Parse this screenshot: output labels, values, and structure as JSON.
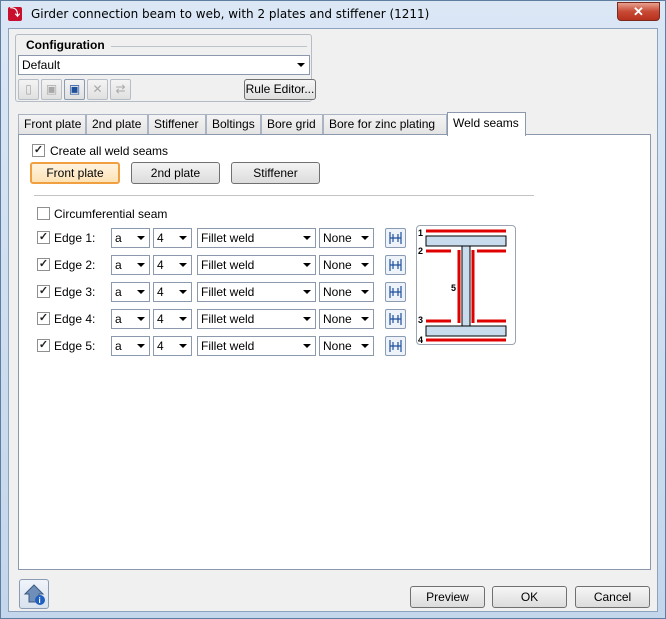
{
  "window": {
    "title": "Girder connection beam to web, with 2 plates and stiffener (1211)",
    "close_glyph": "✕"
  },
  "configuration": {
    "heading": "Configuration",
    "selected": "Default",
    "rule_editor_label": "Rule Editor..."
  },
  "tabs": [
    {
      "label": "Front plate"
    },
    {
      "label": "2nd plate"
    },
    {
      "label": "Stiffener"
    },
    {
      "label": "Boltings"
    },
    {
      "label": "Bore grid"
    },
    {
      "label": "Bore for zinc plating"
    },
    {
      "label": "Weld seams"
    }
  ],
  "weld": {
    "create_all_label": "Create all weld seams",
    "create_all_checked": true,
    "part_buttons": [
      "Front plate",
      "2nd plate",
      "Stiffener"
    ],
    "active_part": "Front plate",
    "circumferential_label": "Circumferential seam",
    "circumferential_checked": false,
    "edges": [
      {
        "label": "Edge 1:",
        "type": "a",
        "size": "4",
        "weld": "Fillet weld",
        "finish": "None",
        "checked": true
      },
      {
        "label": "Edge 2:",
        "type": "a",
        "size": "4",
        "weld": "Fillet weld",
        "finish": "None",
        "checked": true
      },
      {
        "label": "Edge 3:",
        "type": "a",
        "size": "4",
        "weld": "Fillet weld",
        "finish": "None",
        "checked": true
      },
      {
        "label": "Edge 4:",
        "type": "a",
        "size": "4",
        "weld": "Fillet weld",
        "finish": "None",
        "checked": true
      },
      {
        "label": "Edge 5:",
        "type": "a",
        "size": "4",
        "weld": "Fillet weld",
        "finish": "None",
        "checked": true
      }
    ],
    "diagram_labels": [
      "1",
      "2",
      "3",
      "4",
      "5"
    ],
    "weld_color": "#e00000",
    "plate_color": "#c8dcee"
  },
  "footer": {
    "preview_label": "Preview",
    "ok_label": "OK",
    "cancel_label": "Cancel"
  }
}
